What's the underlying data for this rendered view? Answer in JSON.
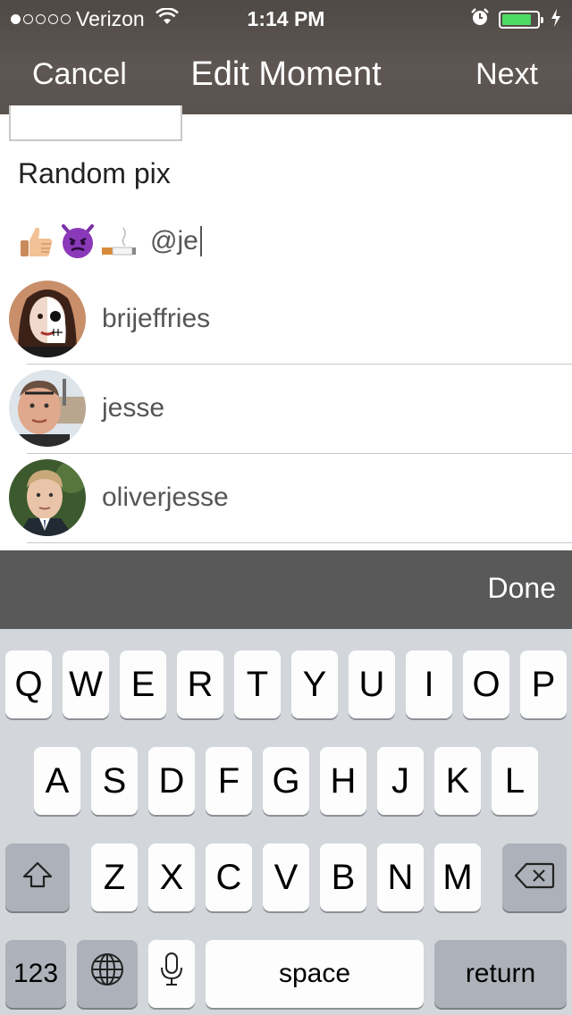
{
  "status_bar": {
    "carrier": "Verizon",
    "time": "1:14 PM",
    "signal_bars_filled": 1,
    "signal_bars_total": 5,
    "battery_level": 0.85,
    "battery_color": "#4cd964",
    "icons": [
      "wifi-icon",
      "alarm-icon",
      "charging-bolt-icon"
    ]
  },
  "nav": {
    "cancel_label": "Cancel",
    "title": "Edit Moment",
    "next_label": "Next",
    "background": "#5a524e"
  },
  "post": {
    "caption": "Random pix",
    "emojis": [
      "thumbs-up-emoji",
      "imp-emoji",
      "cigarette-emoji"
    ],
    "mention_text": "@je"
  },
  "suggestions": [
    {
      "username": "brijeffries",
      "avatar": "avatar-brijeffries"
    },
    {
      "username": "jesse",
      "avatar": "avatar-jesse"
    },
    {
      "username": "oliverjesse",
      "avatar": "avatar-oliverjesse"
    }
  ],
  "done_bar": {
    "done_label": "Done"
  },
  "keyboard": {
    "row1": [
      "Q",
      "W",
      "E",
      "R",
      "T",
      "Y",
      "U",
      "I",
      "O",
      "P"
    ],
    "row2": [
      "A",
      "S",
      "D",
      "F",
      "G",
      "H",
      "J",
      "K",
      "L"
    ],
    "row3": [
      "Z",
      "X",
      "C",
      "V",
      "B",
      "N",
      "M"
    ],
    "numbers_label": "123",
    "space_label": "space",
    "return_label": "return",
    "icons": [
      "shift-icon",
      "backspace-icon",
      "globe-icon",
      "microphone-icon"
    ]
  }
}
